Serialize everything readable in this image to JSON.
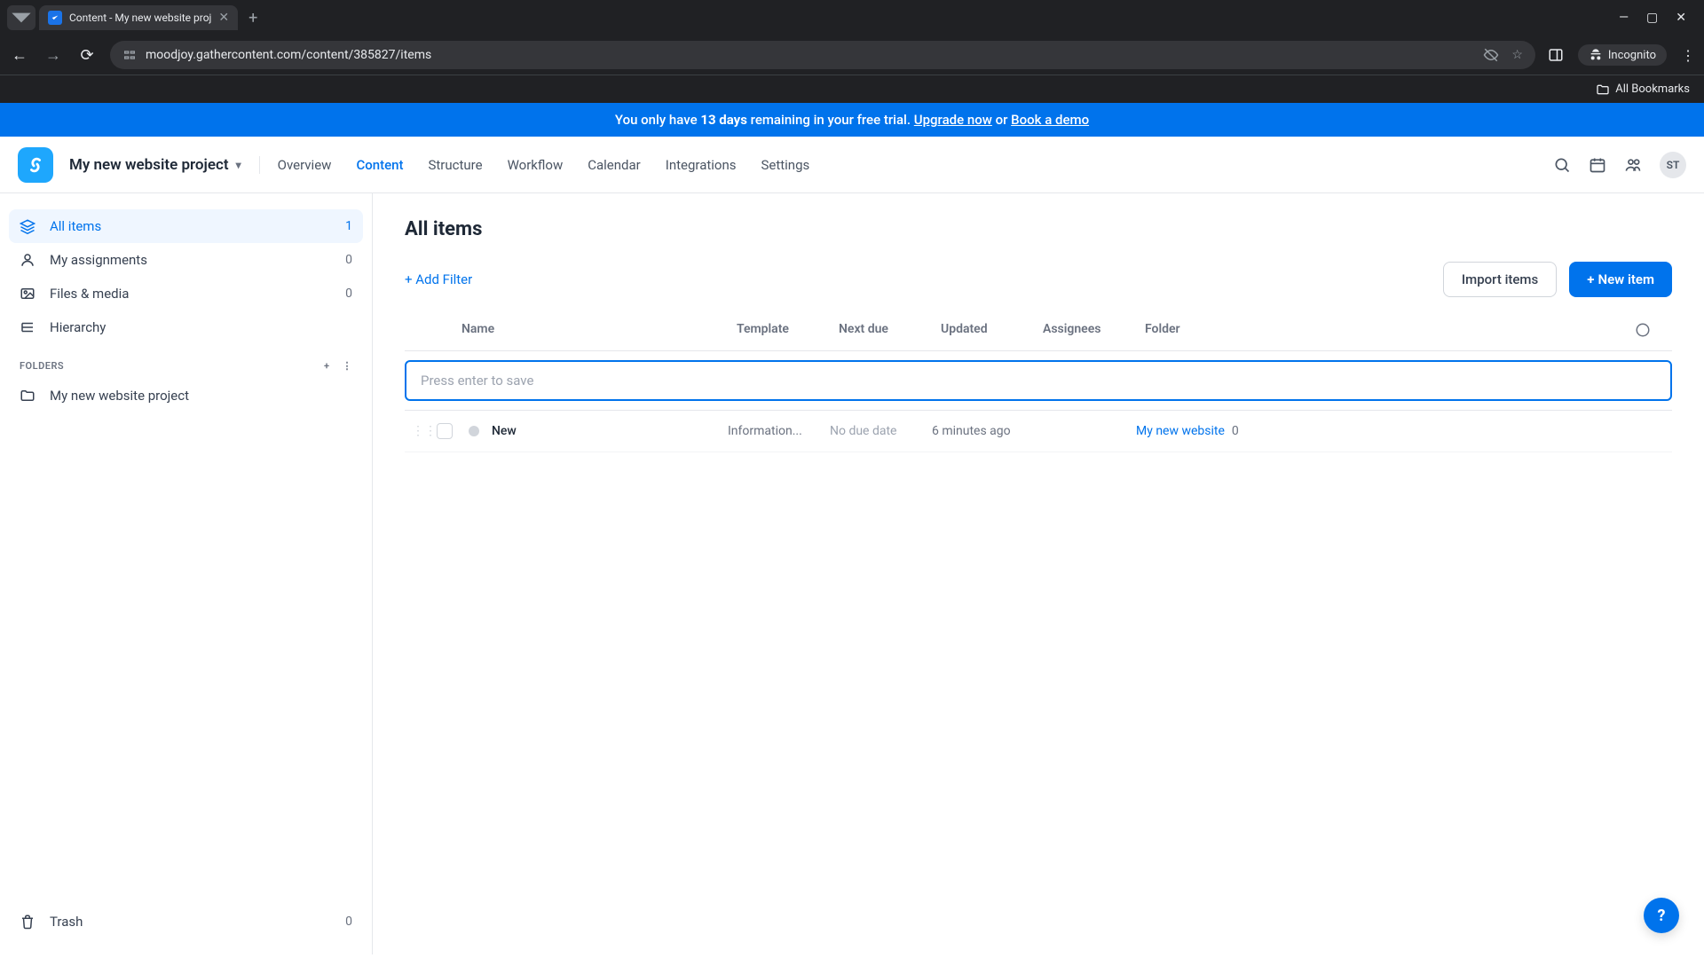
{
  "browser": {
    "tab_title": "Content - My new website proj",
    "url": "moodjoy.gathercontent.com/content/385827/items",
    "incognito_label": "Incognito",
    "bookmarks_label": "All Bookmarks"
  },
  "banner": {
    "prefix": "You only have ",
    "days": "13 days",
    "mid": " remaining in your free trial. ",
    "upgrade": "Upgrade now",
    "or": " or ",
    "demo": "Book a demo"
  },
  "header": {
    "project_name": "My new website project",
    "nav": {
      "overview": "Overview",
      "content": "Content",
      "structure": "Structure",
      "workflow": "Workflow",
      "calendar": "Calendar",
      "integrations": "Integrations",
      "settings": "Settings"
    },
    "avatar_initials": "ST"
  },
  "sidebar": {
    "all_items": {
      "label": "All items",
      "count": "1"
    },
    "my_assignments": {
      "label": "My assignments",
      "count": "0"
    },
    "files_media": {
      "label": "Files & media",
      "count": "0"
    },
    "hierarchy": {
      "label": "Hierarchy"
    },
    "folders_heading": "FOLDERS",
    "folder_1": {
      "label": "My new website project"
    },
    "trash": {
      "label": "Trash",
      "count": "0"
    }
  },
  "main": {
    "title": "All items",
    "add_filter": "+ Add Filter",
    "import_button": "Import items",
    "new_item_button": "New item",
    "columns": {
      "name": "Name",
      "template": "Template",
      "next_due": "Next due",
      "updated": "Updated",
      "assignees": "Assignees",
      "folder": "Folder"
    },
    "new_input_placeholder": "Press enter to save",
    "row": {
      "name": "New",
      "template": "Information...",
      "next_due": "No due date",
      "updated": "6 minutes ago",
      "folder": "My new website",
      "folder_count": "0"
    }
  },
  "help": "?"
}
